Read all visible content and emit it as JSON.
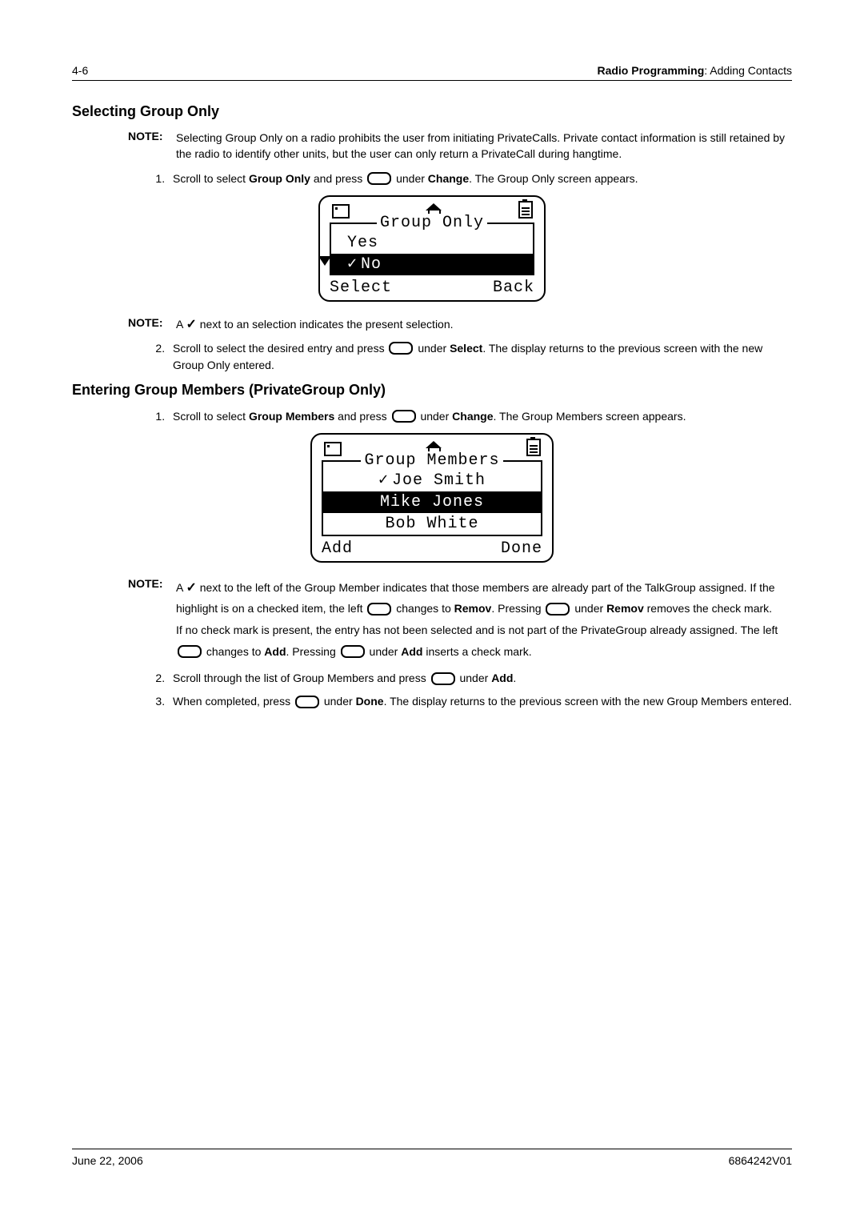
{
  "header": {
    "page_num": "4-6",
    "title_bold": "Radio Programming",
    "title_rest": ": Adding Contacts"
  },
  "s1": {
    "heading": "Selecting Group Only",
    "note_label": "NOTE:",
    "note_text": "Selecting Group Only on a radio prohibits the user from initiating PrivateCalls. Private contact information is still retained by the radio to identify other units, but the user can only return a PrivateCall during hangtime.",
    "step1_a": "Scroll to select ",
    "step1_b": "Group Only",
    "step1_c": " and press ",
    "step1_d": " under ",
    "step1_e": "Change",
    "step1_f": ". The Group Only screen appears.",
    "note2_a": "A ",
    "note2_b": " next to an selection indicates the present selection.",
    "step2_a": "Scroll to select the desired entry and press ",
    "step2_b": " under ",
    "step2_c": "Select",
    "step2_d": ". The display returns to the previous screen with the new Group Only entered."
  },
  "lcd1": {
    "title": "Group Only",
    "opt1": "Yes",
    "opt2": "No",
    "left": "Select",
    "right": "Back"
  },
  "s2": {
    "heading": "Entering Group Members (PrivateGroup Only)",
    "step1_a": "Scroll to select ",
    "step1_b": "Group Members",
    "step1_c": " and press ",
    "step1_d": " under ",
    "step1_e": "Change",
    "step1_f": ". The Group Members screen appears."
  },
  "lcd2": {
    "title": "Group Members",
    "m1": "Joe Smith",
    "m2": "Mike Jones",
    "m3": "Bob White",
    "left": "Add",
    "right": "Done"
  },
  "note3": {
    "a": "A ",
    "b": " next to the left of the Group Member indicates that those members are already part of the TalkGroup assigned. If the highlight is on a checked item, the left ",
    "c": " changes to ",
    "d": "Remov",
    "e": ". Pressing ",
    "f": " under ",
    "g": "Remov",
    "h": " removes the check mark.",
    "i": "If no check mark is present, the entry has not been selected and is not part of the PrivateGroup already assigned. The left ",
    "j": " changes to ",
    "k": "Add",
    "l": ". Pressing ",
    "m": " under ",
    "n": "Add",
    "o": " inserts a check mark."
  },
  "s2b": {
    "step2_a": "Scroll through the list of Group Members and press ",
    "step2_b": " under ",
    "step2_c": "Add",
    "step2_d": ".",
    "step3_a": "When completed, press ",
    "step3_b": " under ",
    "step3_c": "Done",
    "step3_d": ". The display returns to the previous screen with the new Group Members entered."
  },
  "footer": {
    "date": "June 22, 2006",
    "doc": "6864242V01"
  }
}
